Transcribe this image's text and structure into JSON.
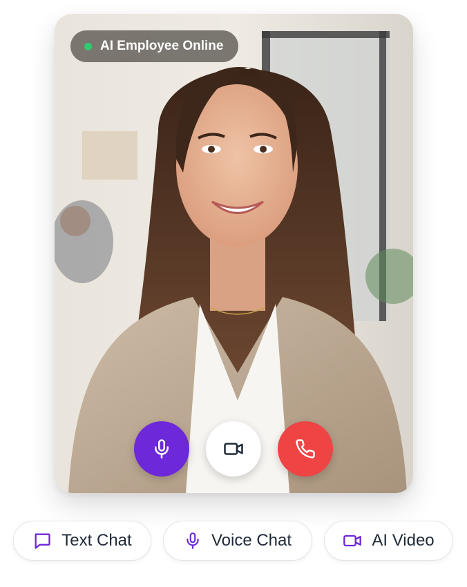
{
  "status": {
    "label": "AI Employee Online",
    "color": "#2ecc71"
  },
  "call_controls": [
    {
      "name": "microphone",
      "icon": "mic-icon",
      "color": "#6d28d9"
    },
    {
      "name": "camera",
      "icon": "video-camera-icon",
      "color": "#ffffff"
    },
    {
      "name": "end-call",
      "icon": "phone-icon",
      "color": "#ef4444"
    }
  ],
  "mode_buttons": [
    {
      "label": "Text Chat",
      "icon": "chat-bubble-icon"
    },
    {
      "label": "Voice Chat",
      "icon": "mic-icon"
    },
    {
      "label": "AI Video",
      "icon": "video-camera-icon"
    }
  ],
  "colors": {
    "accent": "#6d28d9",
    "danger": "#ef4444",
    "online": "#2ecc71"
  }
}
